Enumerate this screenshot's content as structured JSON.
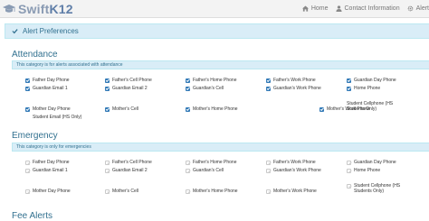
{
  "header": {
    "brand": {
      "swift": "Swift",
      "k12": "K12"
    },
    "nav": [
      {
        "label": "Home",
        "icon": "home-icon"
      },
      {
        "label": "Contact Information",
        "icon": "user-icon"
      },
      {
        "label": "Alert",
        "icon": "gear-icon"
      }
    ]
  },
  "panel": {
    "title": "Alert Preferences"
  },
  "attendance": {
    "title": "Attendance",
    "info": "This category is for alerts associated with attendance",
    "row1": [
      "Father Day Phone",
      "Father's Cell Phone",
      "Father's Home Phone",
      "Father's Work Phone",
      "Guardian Day Phone"
    ],
    "row2": [
      "Guardian Email 1",
      "Guardian Email 2",
      "Guardian's Cell",
      "Guardian's Work Phone",
      "Home Phone"
    ],
    "row3": [
      "Mother Day Phone",
      "Mother's Cell",
      "Mother's Home Phone",
      "Mother's Work Phone",
      "Student Cellphone (HS Students Only)"
    ],
    "row4": [
      "Student Email (HS Only)"
    ]
  },
  "emergency": {
    "title": "Emergency",
    "info": "This category is only for emergencies",
    "row1": [
      "Father Day Phone",
      "Father's Cell Phone",
      "Father's Home Phone",
      "Father's Work Phone",
      "Guardian Day Phone"
    ],
    "row2": [
      "Guardian Email 1",
      "Guardian Email 2",
      "Guardian's Cell",
      "Guardian's Work Phone",
      "Home Phone"
    ],
    "row3": [
      "Mother Day Phone",
      "Mother's Cell",
      "Mother's Home Phone",
      "Mother's Work Phone",
      "Student Cellphone (HS Students Only)"
    ]
  },
  "fee": {
    "title": "Fee Alerts"
  },
  "colors": {
    "accent": "#337ab7",
    "info_bg": "#d9edf7",
    "info_text": "#31708f"
  }
}
